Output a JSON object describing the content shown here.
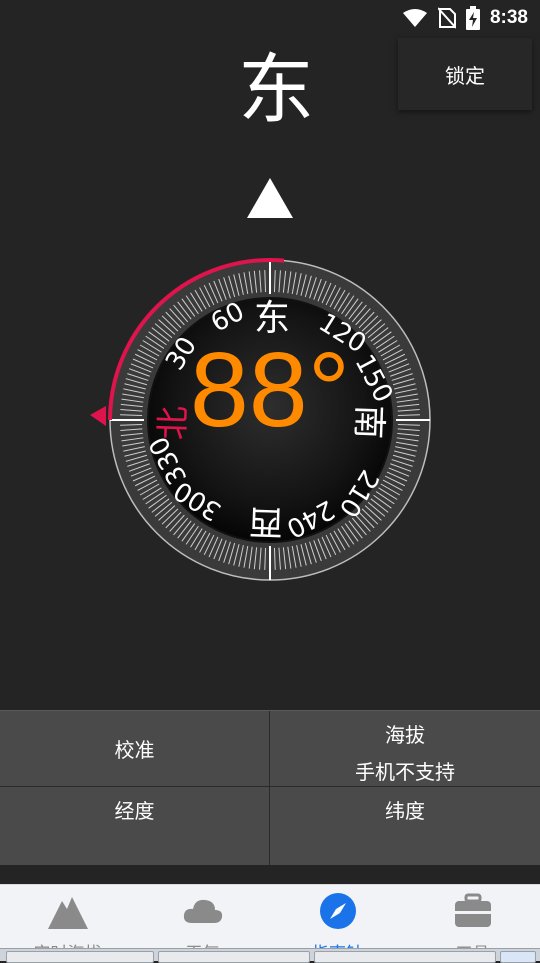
{
  "status_bar": {
    "time": "8:38",
    "icons": [
      "wifi-icon",
      "no-sim-icon",
      "battery-charging-icon"
    ]
  },
  "lock_button": {
    "label": "锁定"
  },
  "heading": {
    "direction": "东",
    "degree": "88°"
  },
  "dial": {
    "north": "北",
    "east": "东",
    "south": "南",
    "west": "西",
    "degree_labels": [
      "30",
      "60",
      "120",
      "150",
      "210",
      "240",
      "300",
      "330"
    ]
  },
  "info": {
    "calibrate": "校准",
    "altitude_label": "海拔",
    "altitude_value": "手机不支持",
    "longitude_label": "经度",
    "latitude_label": "纬度"
  },
  "nav": {
    "items": [
      {
        "label": "实时海拔",
        "icon": "mountain-icon"
      },
      {
        "label": "天气",
        "icon": "cloud-icon"
      },
      {
        "label": "指南针",
        "icon": "compass-icon"
      },
      {
        "label": "工具",
        "icon": "toolbox-icon"
      }
    ],
    "active_index": 2
  },
  "colors": {
    "background": "#242424",
    "accent": "#ff8a00",
    "north_red": "#e0144c",
    "nav_active": "#1a73e8",
    "nav_inactive": "#8a8a8a"
  }
}
